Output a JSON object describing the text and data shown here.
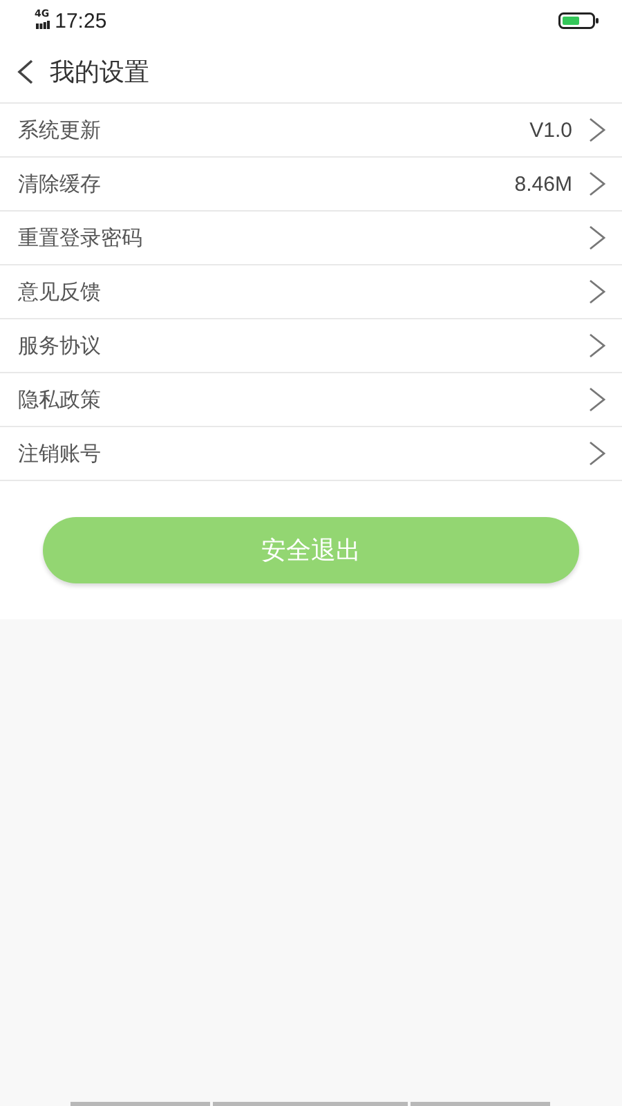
{
  "status_bar": {
    "network": "4G",
    "time": "17:25"
  },
  "header": {
    "title": "我的设置"
  },
  "rows": [
    {
      "label": "系统更新",
      "value": "V1.0"
    },
    {
      "label": "清除缓存",
      "value": "8.46M"
    },
    {
      "label": "重置登录密码"
    },
    {
      "label": "意见反馈"
    },
    {
      "label": "服务协议"
    },
    {
      "label": "隐私政策"
    },
    {
      "label": "注销账号"
    }
  ],
  "logout_button": "安全退出"
}
